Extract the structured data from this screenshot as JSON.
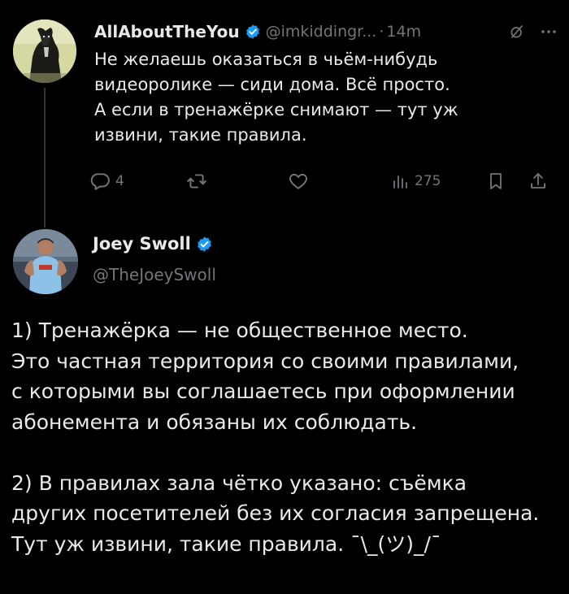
{
  "reply_tweet": {
    "display_name": "AllAboutTheYou",
    "handle": "@imkiddingr...",
    "separator": "·",
    "time": "14m",
    "text_lines": [
      "Не желаешь оказаться в чьём-нибудь",
      "видеоролике — сиди дома. Всё просто.",
      "А если в тренажёрке снимают — тут уж",
      "извини, такие правила."
    ],
    "reply_count": "4",
    "views_count": "275"
  },
  "main_tweet": {
    "display_name": "Joey Swoll",
    "handle": "@TheJoeySwoll",
    "paragraph1": [
      "1) Тренажёрка — не общественное место.",
      "Это частная территория со своими правилами,",
      "с которыми вы соглашаетесь при оформлении",
      "абонемента и обязаны их соблюдать."
    ],
    "paragraph2": [
      "2) В правилах зала чётко указано: съёмка",
      "других посетителей без их согласия запрещена.",
      "Тут уж извини, такие правила. ¯\\_(ツ)_/¯"
    ]
  },
  "icons": {
    "verified": "verified-badge-icon",
    "grok": "grok-icon",
    "more": "more-icon",
    "reply": "reply-icon",
    "retweet": "retweet-icon",
    "like": "like-icon",
    "views": "views-icon",
    "bookmark": "bookmark-icon",
    "share": "share-icon"
  },
  "colors": {
    "background": "#000000",
    "text_primary": "#e7e9ea",
    "text_secondary": "#71767b",
    "verified_blue": "#1d9bf0"
  }
}
